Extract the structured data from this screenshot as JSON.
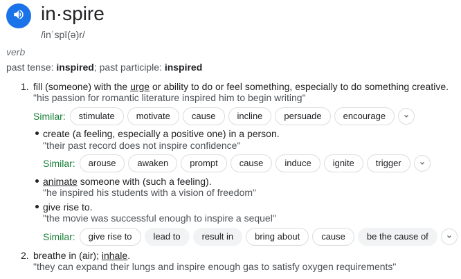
{
  "entry": {
    "word": "in·spire",
    "phonetic": "/inˈspī(ə)r/",
    "part_of_speech": "verb",
    "forms": {
      "past_tense_label": "past tense: ",
      "past_tense": "inspired",
      "sep": "; ",
      "past_participle_label": "past participle: ",
      "past_participle": "inspired"
    }
  },
  "similar_label": "Similar:",
  "senses": [
    {
      "number": "1.",
      "definition_pre": "fill (someone) with the ",
      "definition_link": "urge",
      "definition_post": " or ability to do or feel something, especially to do something creative.",
      "example": "\"his passion for romantic literature inspired him to begin writing\"",
      "similar": [
        "stimulate",
        "motivate",
        "cause",
        "incline",
        "persuade",
        "encourage"
      ],
      "subsenses": [
        {
          "definition": "create (a feeling, especially a positive one) in a person.",
          "example": "\"their past record does not inspire confidence\"",
          "similar": [
            "arouse",
            "awaken",
            "prompt",
            "cause",
            "induce",
            "ignite",
            "trigger"
          ]
        },
        {
          "definition_link": "animate",
          "definition_post": " someone with (such a feeling).",
          "example": "\"he inspired his students with a vision of freedom\""
        },
        {
          "definition": "give rise to.",
          "example": "\"the movie was successful enough to inspire a sequel\"",
          "similar": [
            "give rise to",
            "lead to",
            "result in",
            "bring about",
            "cause",
            "be the cause of"
          ]
        }
      ]
    },
    {
      "number": "2.",
      "definition_pre": "breathe in (air); ",
      "definition_link": "inhale",
      "definition_post": ".",
      "example": "\"they can expand their lungs and inspire enough gas to satisfy oxygen requirements\""
    }
  ]
}
